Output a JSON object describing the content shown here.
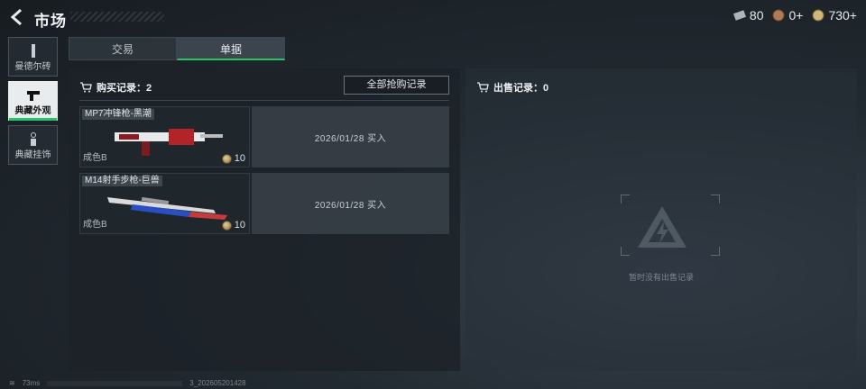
{
  "header": {
    "title": "市场",
    "currencies": [
      {
        "icon": "ticket-icon",
        "value": "80"
      },
      {
        "icon": "medal-coin-icon",
        "value": "0+"
      },
      {
        "icon": "gold-coin-icon",
        "value": "730+"
      }
    ]
  },
  "sidebar": {
    "items": [
      {
        "label": "曼德尔砖",
        "icon": "brick-icon",
        "active": false
      },
      {
        "label": "典藏外观",
        "icon": "pistol-icon",
        "active": true
      },
      {
        "label": "典藏挂饰",
        "icon": "charm-icon",
        "active": false
      }
    ]
  },
  "tabs": [
    {
      "label": "交易",
      "active": false
    },
    {
      "label": "单据",
      "active": true
    }
  ],
  "buy_panel": {
    "title": "购买记录：2",
    "all_button": "全部抢购记录",
    "records": [
      {
        "name": "MP7冲锋枪-黑潮",
        "condition": "成色B",
        "price": "10",
        "date": "2026/01/28 买入"
      },
      {
        "name": "M14射手步枪-巨兽",
        "condition": "成色B",
        "price": "10",
        "date": "2026/01/28 买入"
      }
    ]
  },
  "sell_panel": {
    "title": "出售记录：0",
    "empty_text": "暂时没有出售记录"
  },
  "statusbar": {
    "ping": "73ms",
    "build": "3_202605201428"
  },
  "colors": {
    "accent": "#27c46a",
    "background": "#1d2329"
  }
}
